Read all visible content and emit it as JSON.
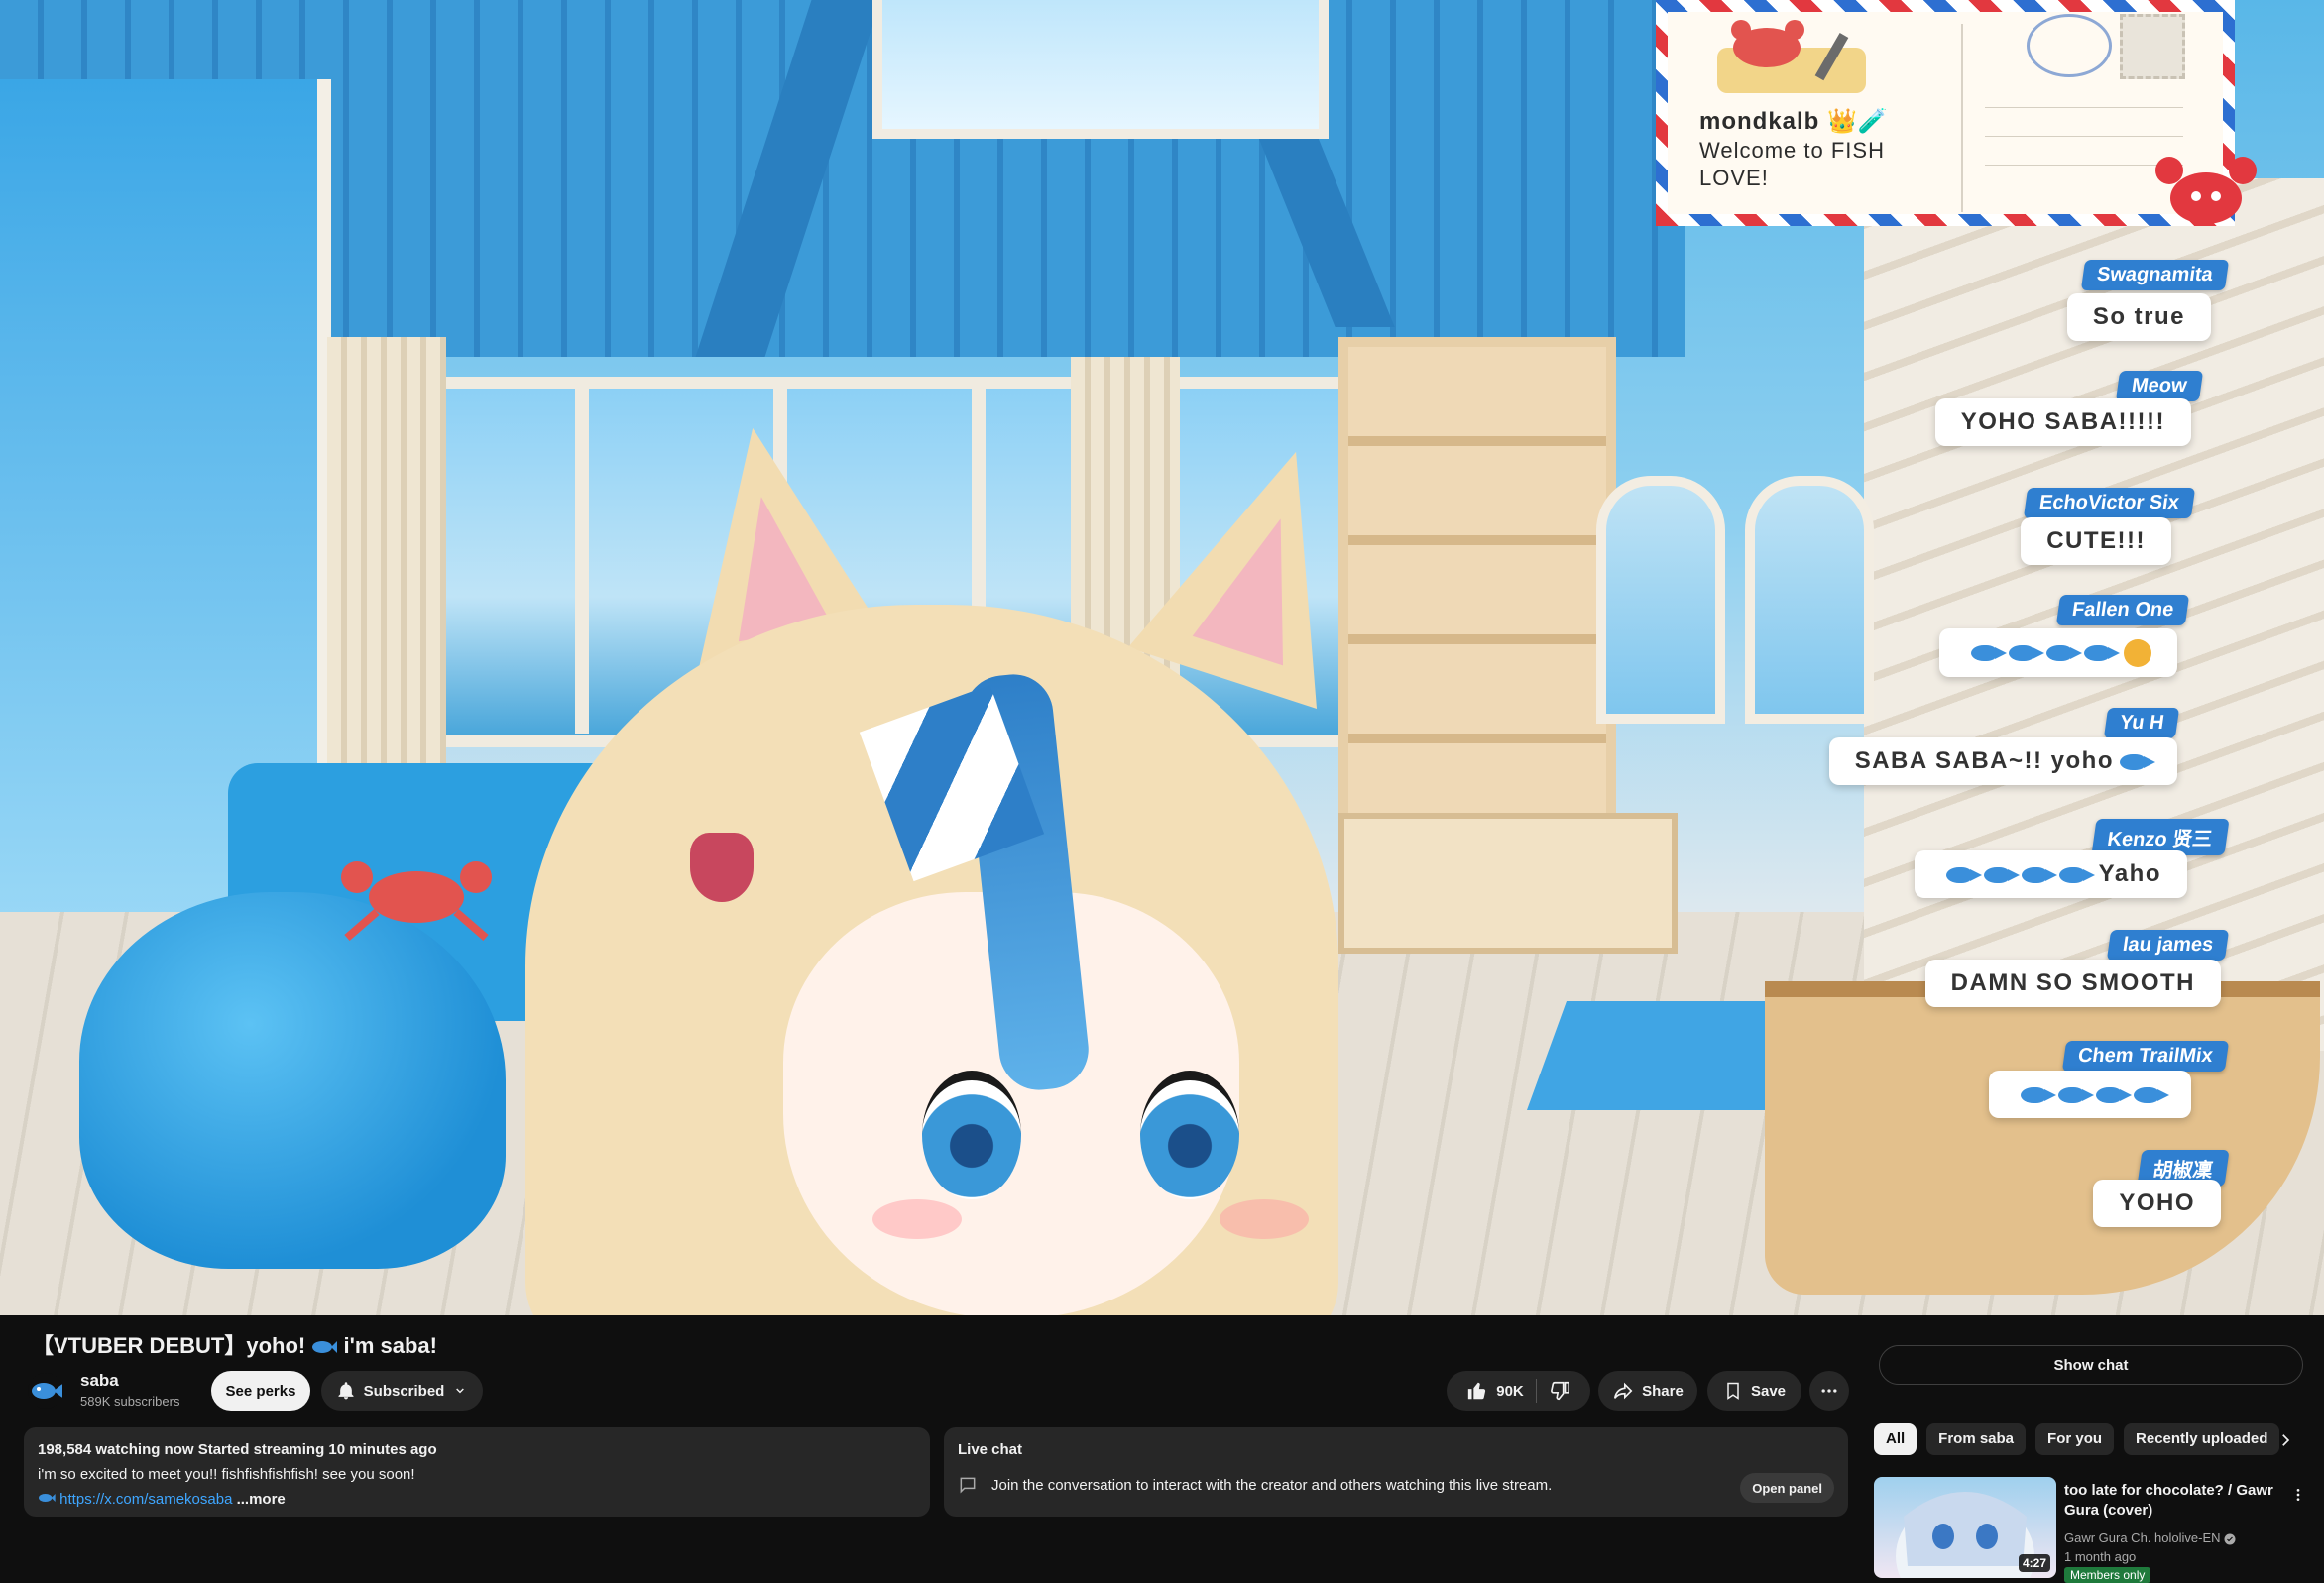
{
  "postcard": {
    "username": "mondkalb 👑🧪",
    "message": "Welcome to FISH LOVE!"
  },
  "overlay_chat": [
    {
      "name": "Swagnamita",
      "message": "So true"
    },
    {
      "name": "Meow",
      "message": "YOHO SABA!!!!!"
    },
    {
      "name": "EchoVictor Six",
      "message": "CUTE!!!"
    },
    {
      "name": "Fallen One",
      "message": "🐟🐟🐟🐟😠"
    },
    {
      "name": "Yu H",
      "message": "SABA SABA~!! yoho"
    },
    {
      "name": "Kenzo 贤三",
      "message": "Yaho"
    },
    {
      "name": "lau james",
      "message": "DAMN SO SMOOTH"
    },
    {
      "name": "Chem TrailMix",
      "message": ""
    },
    {
      "name": "胡椒凜",
      "message": "YOHO"
    }
  ],
  "video": {
    "title_prefix": "【VTUBER DEBUT】yoho!",
    "title_suffix": "i'm saba!"
  },
  "channel": {
    "name": "saba",
    "subscribers": "589K subscribers",
    "perks_label": "See perks",
    "subscribed_label": "Subscribed"
  },
  "actions": {
    "likes": "90K",
    "share": "Share",
    "save": "Save"
  },
  "description": {
    "stats": "198,584 watching now  Started streaming 10 minutes ago",
    "text": "i'm so excited to meet you!! fishfishfishfish! see you soon!",
    "link": "https://x.com/samekosaba",
    "more": "...more"
  },
  "live_chat": {
    "title": "Live chat",
    "prompt": "Join the conversation to interact with the creator and others watching this live stream.",
    "open_panel": "Open panel"
  },
  "sidebar": {
    "show_chat": "Show chat",
    "chips": [
      "All",
      "From saba",
      "For you",
      "Recently uploaded"
    ],
    "recommendation": {
      "title": "too late for chocolate? / Gawr Gura (cover)",
      "channel": "Gawr Gura Ch. hololive-EN",
      "age": "1 month ago",
      "duration": "4:27",
      "badge": "Members only"
    }
  },
  "colors": {
    "accent_link": "#3ea6ff",
    "chat_name_bg": "#2f7fd0",
    "background": "#0f0f0f"
  }
}
